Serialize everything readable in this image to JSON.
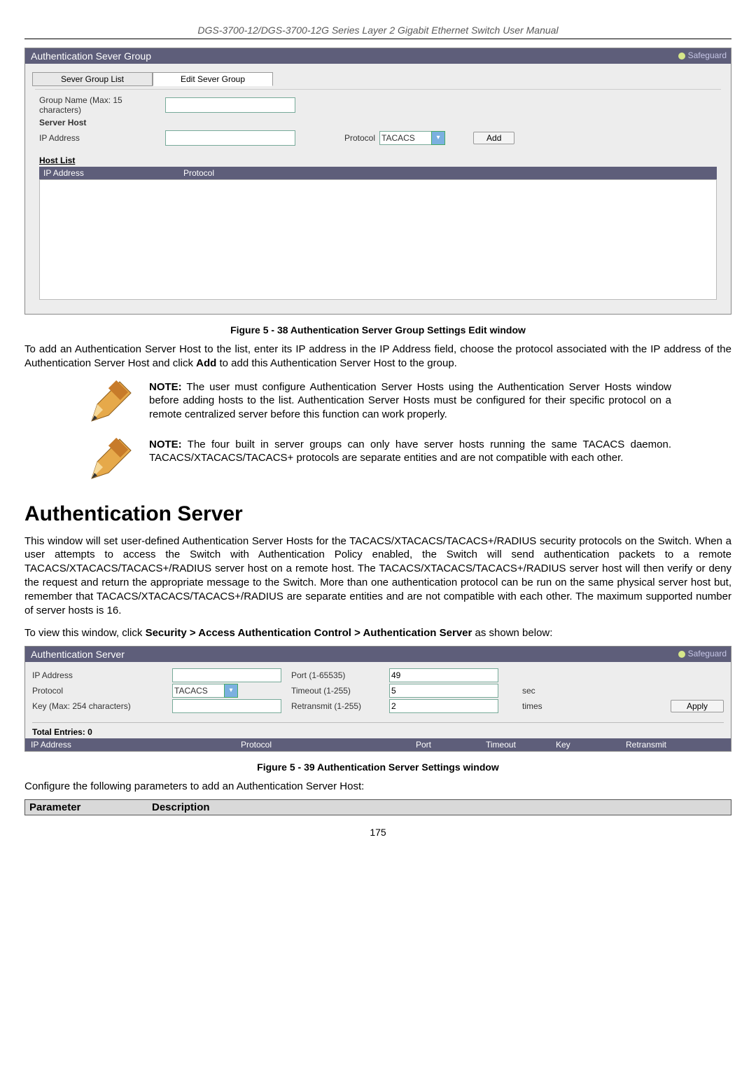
{
  "header": {
    "title": "DGS-3700-12/DGS-3700-12G Series Layer 2 Gigabit Ethernet Switch User Manual"
  },
  "panel1": {
    "title": "Authentication Sever Group",
    "safeguard": "Safeguard",
    "tab1": "Sever Group List",
    "tab2": "Edit Sever Group",
    "groupname_label": "Group Name  (Max: 15 characters)",
    "serverhost_label": "Server Host",
    "ipaddr_label": "IP Address",
    "protocol_label": "Protocol",
    "protocol_value": "TACACS",
    "add_btn": "Add",
    "hostlist_label": "Host List",
    "hostcol_ip": "IP Address",
    "hostcol_proto": "Protocol"
  },
  "figure1": "Figure 5 - 38 Authentication Server Group Settings Edit window",
  "para1": "To add an Authentication Server Host to the list, enter its IP address in the IP Address field, choose the protocol associated with the IP address of the Authentication Server Host and click Add to add this Authentication Server Host to the group.",
  "note1": {
    "bold": "NOTE:",
    "text": " The user must configure Authentication Server Hosts using the Authentication Server Hosts window before adding hosts to the list. Authentication Server Hosts must be configured for their specific protocol on a remote centralized server before this function can work properly."
  },
  "note2": {
    "bold": "NOTE:",
    "text": " The four built in server groups can only have server hosts running the same TACACS daemon. TACACS/XTACACS/TACACS+ protocols are separate entities and are not compatible with each other."
  },
  "section_title": "Authentication Server",
  "para2": "This window will set user-defined Authentication Server Hosts for the TACACS/XTACACS/TACACS+/RADIUS security protocols on the Switch. When a user attempts to access the Switch with Authentication Policy enabled, the Switch will send authentication packets to a remote TACACS/XTACACS/TACACS+/RADIUS server host on a remote host. The TACACS/XTACACS/TACACS+/RADIUS server host will then verify or deny the request and return the appropriate message to the Switch. More than one authentication protocol can be run on the same physical server host but, remember that TACACS/XTACACS/TACACS+/RADIUS are separate entities and are not compatible with each other. The maximum supported number of server hosts is 16.",
  "breadcrumb": {
    "pre": "To view this window, click ",
    "b1": "Security > Access Authentication Control > Authentication Server",
    "post": " as shown below:"
  },
  "panel2": {
    "title": "Authentication Server",
    "safeguard": "Safeguard",
    "ipaddr_label": "IP Address",
    "protocol_label": "Protocol",
    "protocol_value": "TACACS",
    "key_label": "Key (Max: 254 characters)",
    "port_label": "Port (1-65535)",
    "port_value": "49",
    "timeout_label": "Timeout (1-255)",
    "timeout_value": "5",
    "timeout_unit": "sec",
    "retrans_label": "Retransmit (1-255)",
    "retrans_value": "2",
    "retrans_unit": "times",
    "apply_btn": "Apply",
    "total": "Total Entries: 0",
    "cols": {
      "c1": "IP Address",
      "c2": "Protocol",
      "c3": "Port",
      "c4": "Timeout",
      "c5": "Key",
      "c6": "Retransmit"
    }
  },
  "figure2": "Figure 5 - 39 Authentication Server Settings window",
  "para3": "Configure the following parameters to add an Authentication Server Host:",
  "paramtable": {
    "h1": "Parameter",
    "h2": "Description"
  },
  "pagenum": "175"
}
